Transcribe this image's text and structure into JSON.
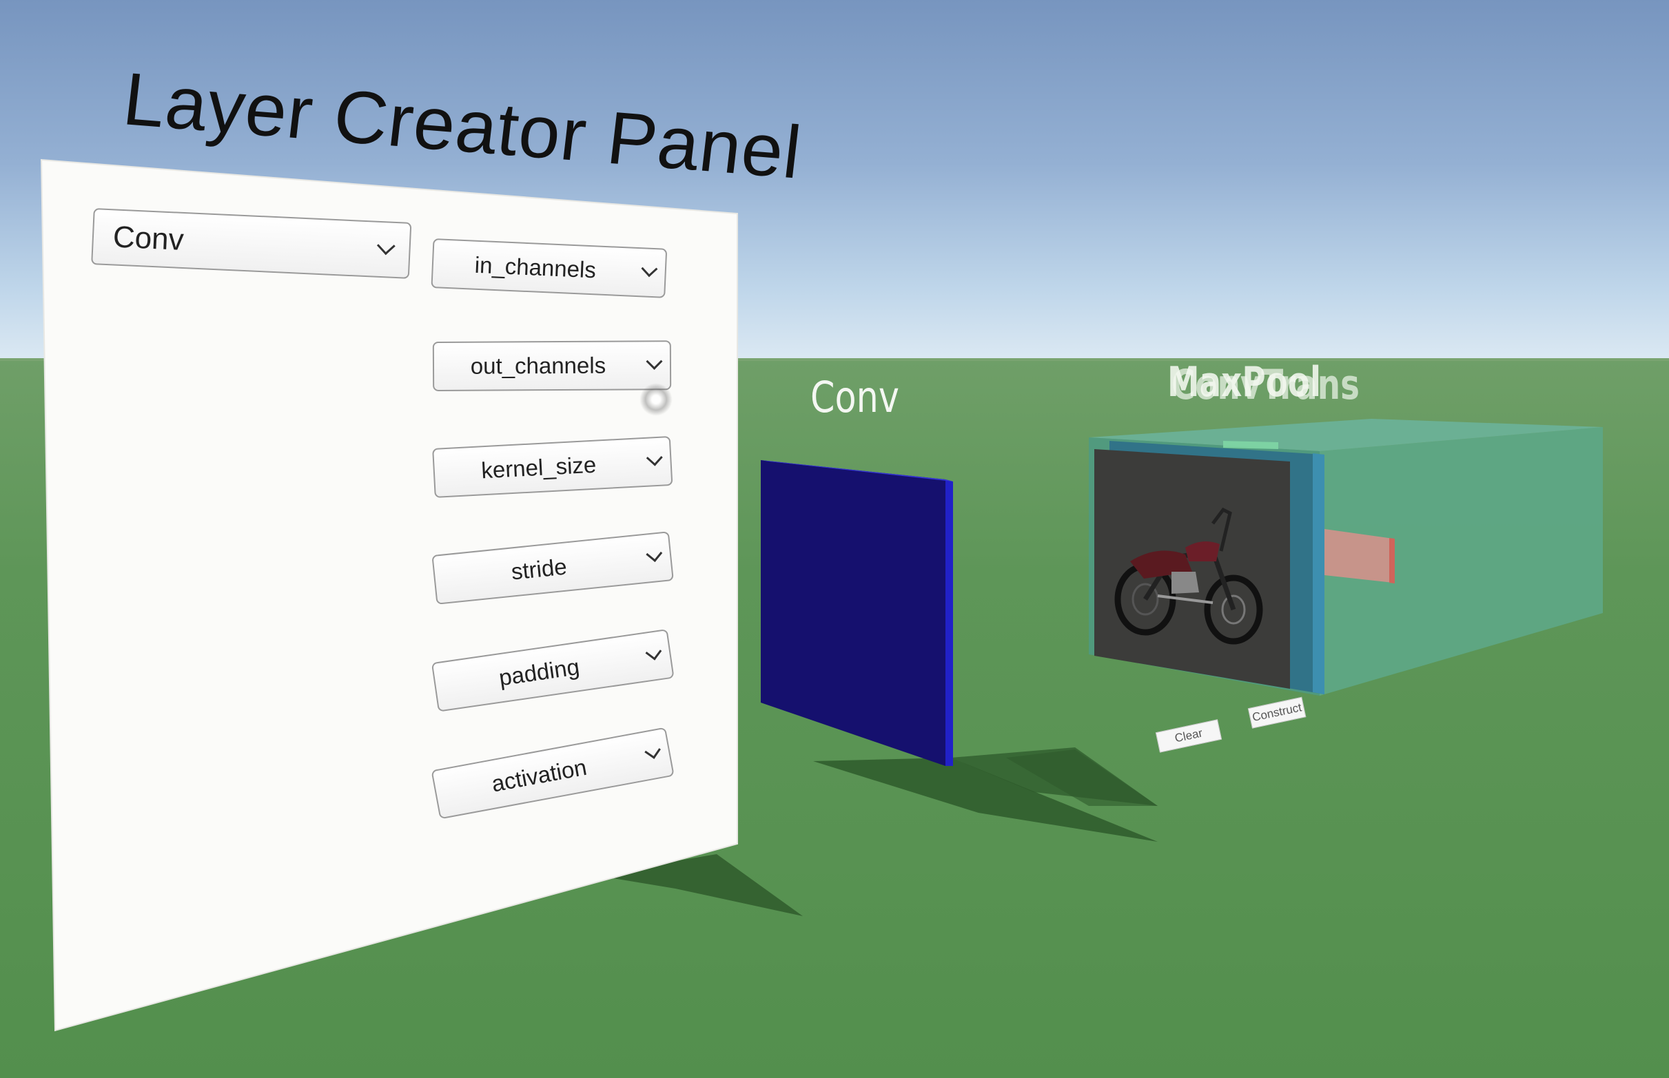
{
  "panel": {
    "title": "Layer Creator Panel",
    "layer_type_dropdown": {
      "selected": "Conv"
    },
    "parameter_dropdowns": [
      {
        "label": "in_channels"
      },
      {
        "label": "out_channels"
      },
      {
        "label": "kernel_size"
      },
      {
        "label": "stride"
      },
      {
        "label": "padding"
      },
      {
        "label": "activation"
      }
    ]
  },
  "scene": {
    "conv_layer": {
      "label": "Conv",
      "color": "#15106e"
    },
    "stack": {
      "label_front": "MaxPool",
      "label_back": "ConvTrans",
      "box_color": "#5fa88e"
    },
    "buttons": {
      "clear_label": "Clear",
      "construct_label": "Construct"
    },
    "colors": {
      "sky_top": "#7795bf",
      "sky_bottom": "#dce9f3",
      "ground": "#5e9658"
    }
  }
}
